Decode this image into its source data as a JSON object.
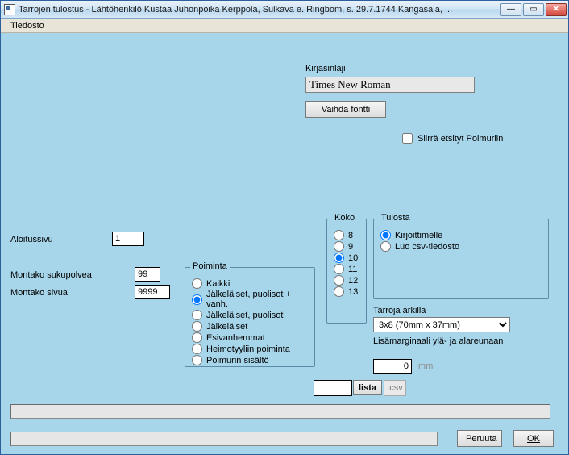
{
  "window": {
    "title": "Tarrojen tulostus - Lähtöhenkilö Kustaa Juhonpoika Kerppola, Sulkava e. Ringbom,  s. 29.7.1744 Kangasala, ..."
  },
  "menu": {
    "file": "Tiedosto"
  },
  "font": {
    "label": "Kirjasinlaji",
    "value": "Times New Roman",
    "change_btn": "Vaihda fontti"
  },
  "transfer_checkbox": "Siirrä etsityt Poimuriin",
  "inputs": {
    "start_page_label": "Aloitussivu",
    "start_page_value": "1",
    "generations_label": "Montako sukupolvea",
    "generations_value": "99",
    "pages_label": "Montako sivua",
    "pages_value": "9999"
  },
  "poiminta": {
    "legend": "Poiminta",
    "options": [
      "Kaikki",
      "Jälkeläiset, puolisot + vanh.",
      "Jälkeläiset, puolisot",
      "Jälkeläiset",
      "Esivanhemmat",
      "Heimotyyliin poiminta",
      "Poimurin sisältö"
    ],
    "selected": 1
  },
  "koko": {
    "legend": "Koko",
    "options": [
      "8",
      "9",
      "10",
      "11",
      "12",
      "13"
    ],
    "selected": 2
  },
  "tulosta": {
    "legend": "Tulosta",
    "options": [
      "Kirjoittimelle",
      "Luo csv-tiedosto"
    ],
    "selected": 0
  },
  "sheet": {
    "label": "Tarroja arkilla",
    "value": "3x8 (70mm x 37mm)"
  },
  "margin": {
    "label": "Lisämarginaali ylä- ja alareunaan",
    "value": "0",
    "unit": "mm"
  },
  "list_btn": "lista",
  "csv_ext": ".csv",
  "buttons": {
    "cancel": "Peruuta",
    "ok": "OK"
  }
}
